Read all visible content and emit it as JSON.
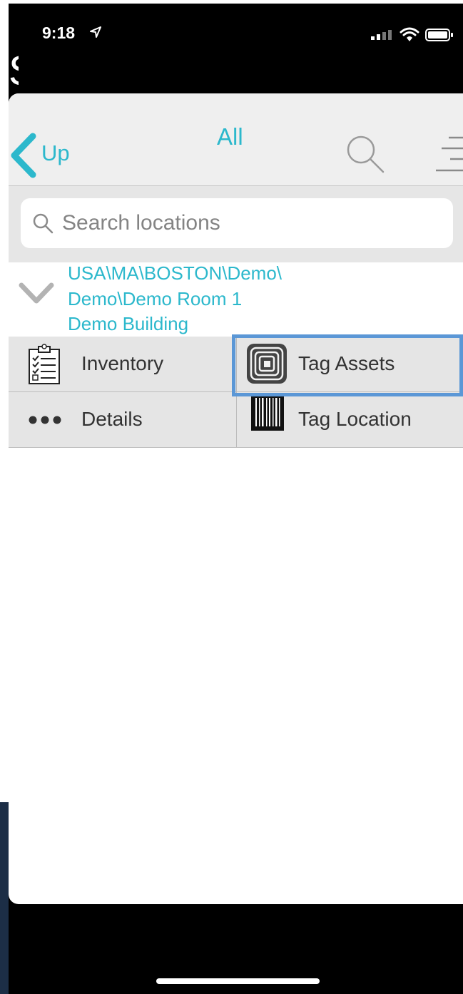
{
  "status_bar": {
    "time": "9:18",
    "location_icon": "location-arrow-icon",
    "signal_icon": "cellular-signal-icon",
    "wifi_icon": "wifi-icon",
    "battery_icon": "battery-icon"
  },
  "background": {
    "glyph": "S"
  },
  "navbar": {
    "back_label": "Up",
    "title": "All",
    "search_icon": "search-icon",
    "menu_icon": "menu-lines-icon"
  },
  "search": {
    "placeholder": "Search locations",
    "value": ""
  },
  "location": {
    "lines": [
      "USA\\MA\\BOSTON\\Demo\\",
      "Demo\\Demo Room 1",
      "Demo Building"
    ]
  },
  "actions": [
    {
      "label": "Inventory",
      "icon": "checklist-icon"
    },
    {
      "label": "Tag Assets",
      "icon": "rfid-tag-icon"
    },
    {
      "label": "Details",
      "icon": "more-dots-icon"
    },
    {
      "label": "Tag Location",
      "icon": "barcode-icon"
    }
  ],
  "colors": {
    "accent": "#2cb8cc",
    "highlight": "#5b97d6",
    "navbar_bg": "#efefef",
    "action_bg": "#e5e5e5"
  }
}
